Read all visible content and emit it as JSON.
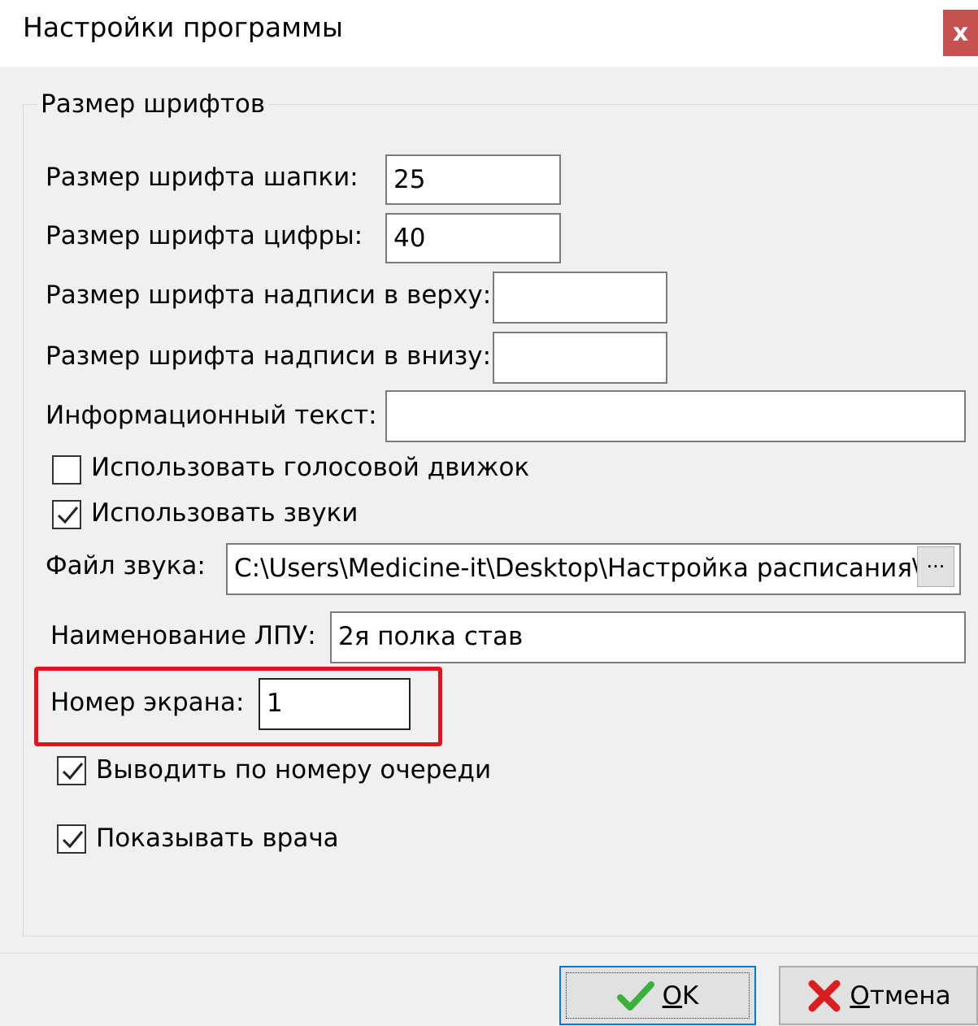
{
  "window": {
    "title": "Настройки программы",
    "close_label": "x"
  },
  "group": {
    "legend": "Размер шрифтов"
  },
  "fields": {
    "header_font": {
      "label": "Размер шрифта шапки:",
      "value": "25"
    },
    "digit_font": {
      "label": "Размер шрифта цифры:",
      "value": "40"
    },
    "top_font": {
      "label": "Размер шрифта надписи в верху:",
      "value": ""
    },
    "bottom_font": {
      "label": "Размер шрифта надписи в внизу:",
      "value": ""
    },
    "info_text": {
      "label": "Информационный текст:",
      "value": ""
    },
    "sound_file": {
      "label": "Файл звука:",
      "value": "C:\\Users\\Medicine-it\\Desktop\\Настройка расписания\\K",
      "browse_label": "···"
    },
    "lpu_name": {
      "label": "Наименование ЛПУ:",
      "value": "2я полка став"
    },
    "screen_number": {
      "label": "Номер экрана:",
      "value": "1"
    }
  },
  "checkboxes": {
    "voice_engine": {
      "label": "Использовать голосовой движок",
      "checked": false
    },
    "use_sounds": {
      "label": "Использовать звуки",
      "checked": true
    },
    "by_queue_number": {
      "label": "Выводить по номеру очереди",
      "checked": true
    },
    "show_doctor": {
      "label": "Показывать врача",
      "checked": true
    }
  },
  "buttons": {
    "ok": {
      "mnemonic": "O",
      "rest": "K"
    },
    "cancel": {
      "mnemonic": "О",
      "rest": "тмена"
    }
  },
  "colors": {
    "highlight": "#e8101a",
    "close": "#c75050",
    "focus": "#0078d7"
  }
}
